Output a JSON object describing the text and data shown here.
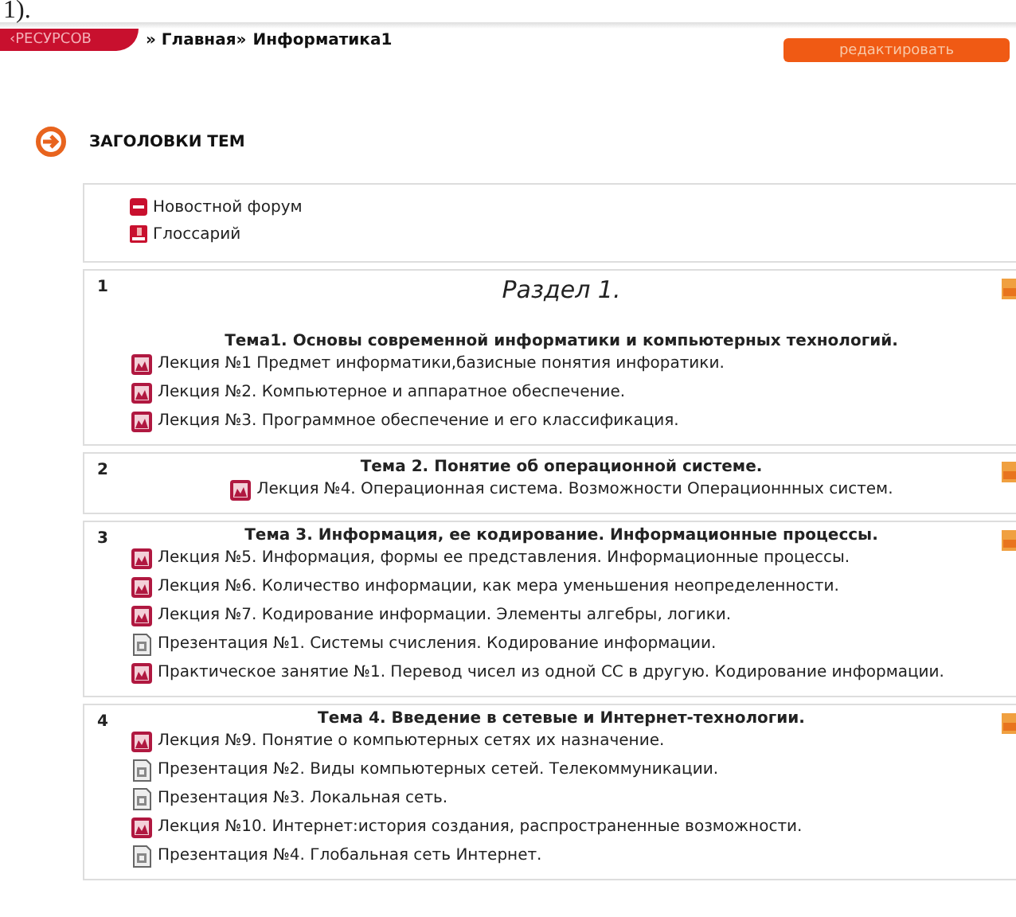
{
  "top_fragment": "1).",
  "breadcrumb": {
    "tab": "‹РЕСУРСОВ",
    "links": [
      "» Главная»",
      "Информатика1"
    ]
  },
  "edit_button": "редактировать",
  "heading": "ЗАГОЛОВКИ ТЕМ",
  "general_items": [
    {
      "kind": "forum",
      "label": "Новостной форум"
    },
    {
      "kind": "glossary",
      "label": "Глоссарий"
    }
  ],
  "sections": [
    {
      "number": "1",
      "title": "Раздел 1.",
      "topic": "Тема1. Основы современной информатики и компьютерных технологий.",
      "items": [
        {
          "kind": "lecture",
          "label": "Лекция №1 Предмет информатики,базисные понятия инфоратики."
        },
        {
          "kind": "lecture",
          "label": "Лекция №2. Компьютерное и аппаратное обеспечение."
        },
        {
          "kind": "lecture",
          "label": "Лекция №3. Программное обеспечение и его классификация."
        }
      ]
    },
    {
      "number": "2",
      "topic": "Тема 2. Понятие об операционной системе.",
      "items": [
        {
          "kind": "lecture",
          "label": "Лекция №4. Операционная система. Возможности Операционнных систем."
        }
      ]
    },
    {
      "number": "3",
      "topic": "Тема 3. Информация, ее кодирование. Информационные процессы.",
      "items": [
        {
          "kind": "lecture",
          "label": "Лекция №5. Информация, формы ее представления. Информационные процессы."
        },
        {
          "kind": "lecture",
          "label": "Лекция №6. Количество информации, как мера уменьшения неопределенности."
        },
        {
          "kind": "lecture",
          "label": "Лекция №7. Кодирование информации. Элементы алгебры, логики."
        },
        {
          "kind": "presentation",
          "label": "Презентация №1. Системы счисления. Кодирование информации."
        },
        {
          "kind": "lecture",
          "label": "Практическое занятие №1. Перевод чисел из одной СС в другую. Кодирование информации."
        }
      ]
    },
    {
      "number": "4",
      "topic": "Тема 4. Введение в сетевые и Интернет-технологии.",
      "items": [
        {
          "kind": "lecture",
          "label": "Лекция №9. Понятие о компьютерных сетях их назначение."
        },
        {
          "kind": "presentation",
          "label": "Презентация №2. Виды компьютерных сетей. Телекоммуникации."
        },
        {
          "kind": "presentation",
          "label": "Презентация №3. Локальная сеть."
        },
        {
          "kind": "lecture",
          "label": "Лекция №10. Интернет:история создания, распространенные возможности."
        },
        {
          "kind": "presentation",
          "label": "Презентация №4. Глобальная сеть Интернет."
        }
      ]
    }
  ]
}
